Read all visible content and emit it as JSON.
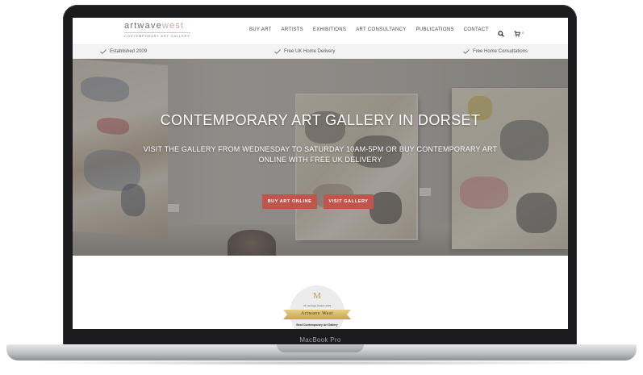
{
  "device": {
    "label": "MacBook Pro"
  },
  "header": {
    "logo": {
      "main_left": "artwave",
      "main_right": "west",
      "tagline": "CONTEMPORARY ART GALLERY"
    },
    "nav": [
      {
        "label": "BUY ART"
      },
      {
        "label": "ARTISTS"
      },
      {
        "label": "EXHIBITIONS"
      },
      {
        "label": "ART CONSULTANCY"
      },
      {
        "label": "PUBLICATIONS"
      },
      {
        "label": "CONTACT"
      }
    ],
    "icons": {
      "search": "search-icon",
      "cart": "cart-icon"
    },
    "cart_count": "0"
  },
  "usp_bar": {
    "items": [
      {
        "label": "Established 2009",
        "icon": "check-icon"
      },
      {
        "label": "Free UK Home Delivery",
        "icon": "check-icon"
      },
      {
        "label": "Free Home Consultations",
        "icon": "check-icon"
      }
    ]
  },
  "hero": {
    "title": "CONTEMPORARY ART GALLERY IN DORSET",
    "subtitle": "VISIT THE GALLERY FROM WEDNESDAY TO SATURDAY 10AM-5PM OR BUY CONTEMPORARY ART ONLINE WITH FREE UK DELIVERY",
    "buttons": {
      "buy": "BUY ART ONLINE",
      "visit": "VISIT GALLERY"
    }
  },
  "award": {
    "monogram": "M",
    "caption": "UK Heritage Awards 2023",
    "name": "Artwave West",
    "category": "Best Contemporary Art Gallery"
  },
  "colors": {
    "accent_button": "#c0564b",
    "logo_accent": "#c9a9a6",
    "award_gold": "#c9a64c"
  }
}
